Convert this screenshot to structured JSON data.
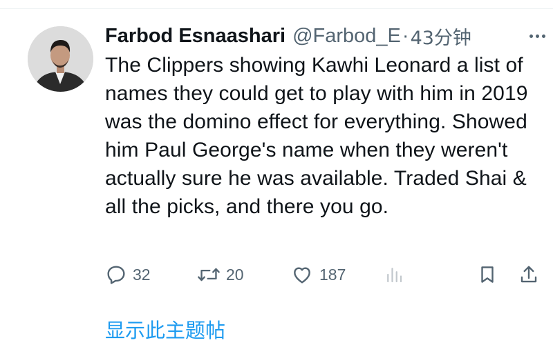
{
  "tweet": {
    "author_name": "Farbod Esnaashari",
    "handle": "@Farbod_E",
    "separator": "·",
    "time": "43分钟",
    "text": "The Clippers showing Kawhi Leonard a list of names they could get to play with him in 2019 was the domino effect for everything. Showed him Paul George's name when they weren't actually sure he was available. Traded Shai & all the picks, and there you go."
  },
  "actions": {
    "reply_count": "32",
    "retweet_count": "20",
    "like_count": "187"
  },
  "show_thread_label": "显示此主题帖",
  "colors": {
    "text": "#0f1419",
    "secondary": "#536471",
    "link": "#1d9bf0"
  },
  "icons": [
    "more-icon",
    "reply-icon",
    "retweet-icon",
    "like-icon",
    "views-icon",
    "bookmark-icon",
    "share-icon"
  ]
}
